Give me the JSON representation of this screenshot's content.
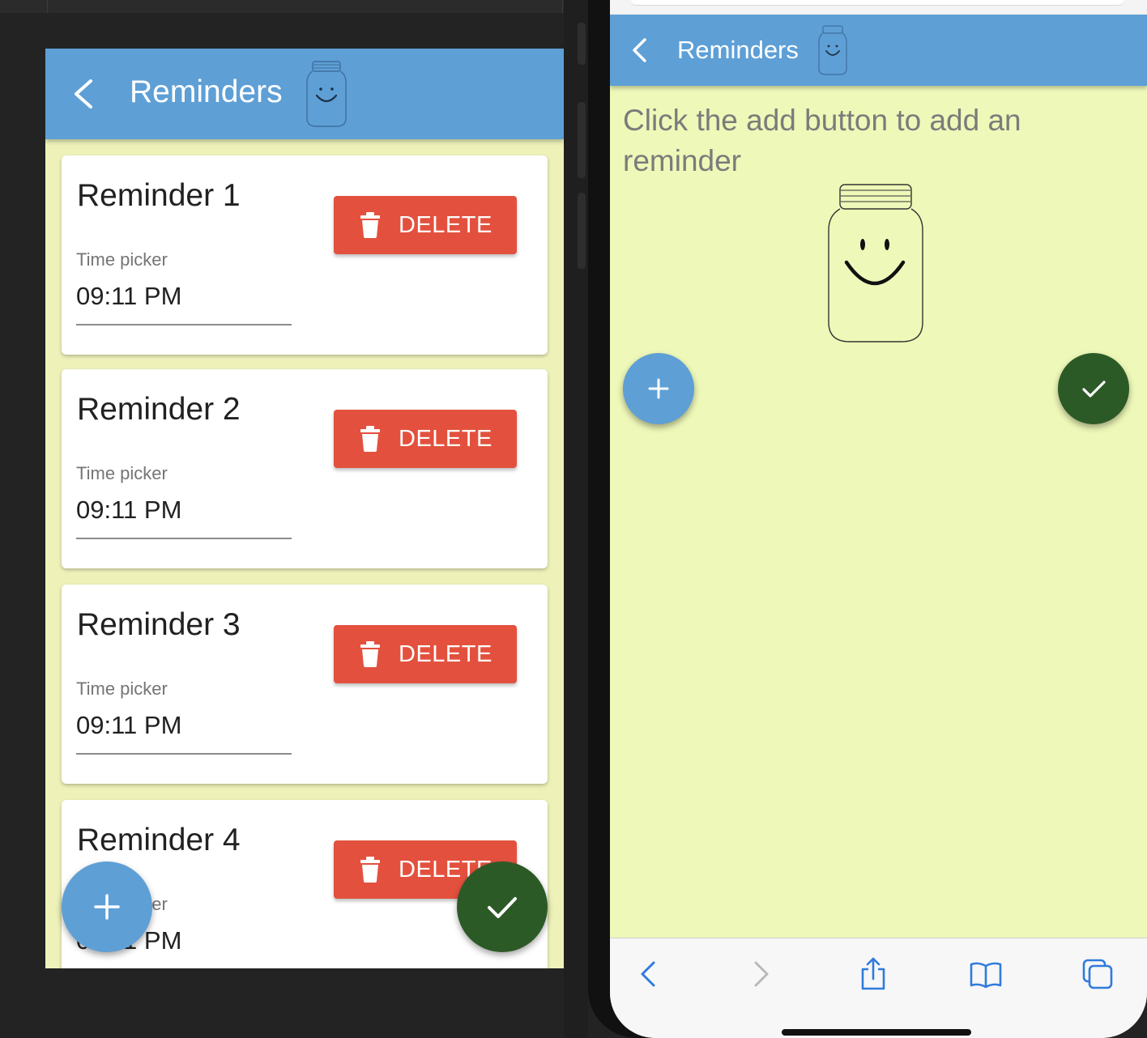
{
  "left": {
    "header": {
      "title": "Reminders"
    },
    "reminders": [
      {
        "title": "Reminder 1",
        "time_label": "Time picker",
        "time_value": "09:11 PM",
        "delete_label": "DELETE"
      },
      {
        "title": "Reminder 2",
        "time_label": "Time picker",
        "time_value": "09:11 PM",
        "delete_label": "DELETE"
      },
      {
        "title": "Reminder 3",
        "time_label": "Time picker",
        "time_value": "09:11 PM",
        "delete_label": "DELETE"
      },
      {
        "title": "Reminder 4",
        "time_label": "Time picker",
        "time_value": "09:11 PM",
        "delete_label": "DELETE"
      }
    ]
  },
  "right": {
    "header": {
      "title": "Reminders"
    },
    "empty_message": "Click the add button to add an reminder"
  },
  "colors": {
    "header_blue": "#5e9fd6",
    "background_yellow": "#eef2b9",
    "delete_red": "#e3513e",
    "done_green": "#2c5a26",
    "safari_blue": "#2f7bdc"
  },
  "icons": [
    "back-arrow-icon",
    "jar-smiley-icon",
    "trash-icon",
    "plus-icon",
    "check-icon",
    "safari-back-icon",
    "safari-forward-icon",
    "share-icon",
    "bookmarks-icon",
    "tabs-icon"
  ]
}
